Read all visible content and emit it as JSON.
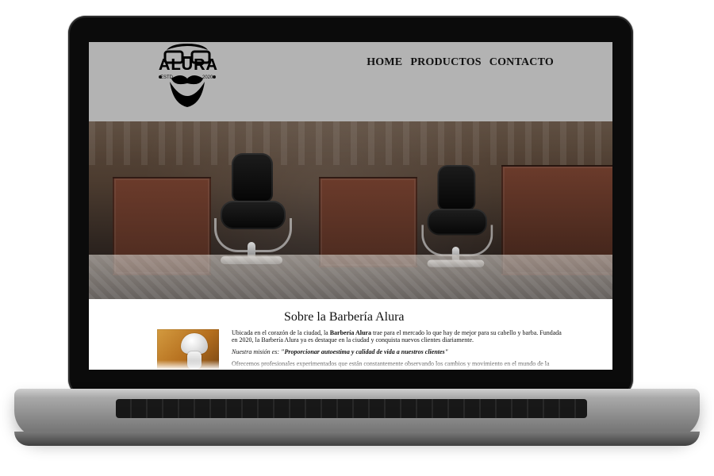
{
  "site": {
    "brand_name": "ALURA",
    "estd_label": "ESTD",
    "year": "2020",
    "nav": [
      {
        "label": "HOME"
      },
      {
        "label": "PRODUCTOS"
      },
      {
        "label": "CONTACTO"
      }
    ]
  },
  "about": {
    "title": "Sobre la Barbería Alura",
    "paragraph_1_prefix": "Ubicada en el corazón de la ciudad, la ",
    "paragraph_1_bold": "Barbería Alura",
    "paragraph_1_suffix": " trae para el mercado lo que hay de mejor para su cabello y barba. Fundada en 2020, la Barbería Alura ya es destaque en la ciudad y conquista nuevos clientes diariamente.",
    "mission_prefix": "Nuestra misión es: ",
    "mission_quote": "\"Proporcionar autoestima y calidad de vida a nuestros clientes\"",
    "paragraph_2": "Ofrecemos profesionales experimentados que están constantemente observando los cambios y movimiento en el mundo de la moda, para así ofrecer a nuestros clientes las últimas tendencias. El atendimiento posee un padrón de"
  }
}
